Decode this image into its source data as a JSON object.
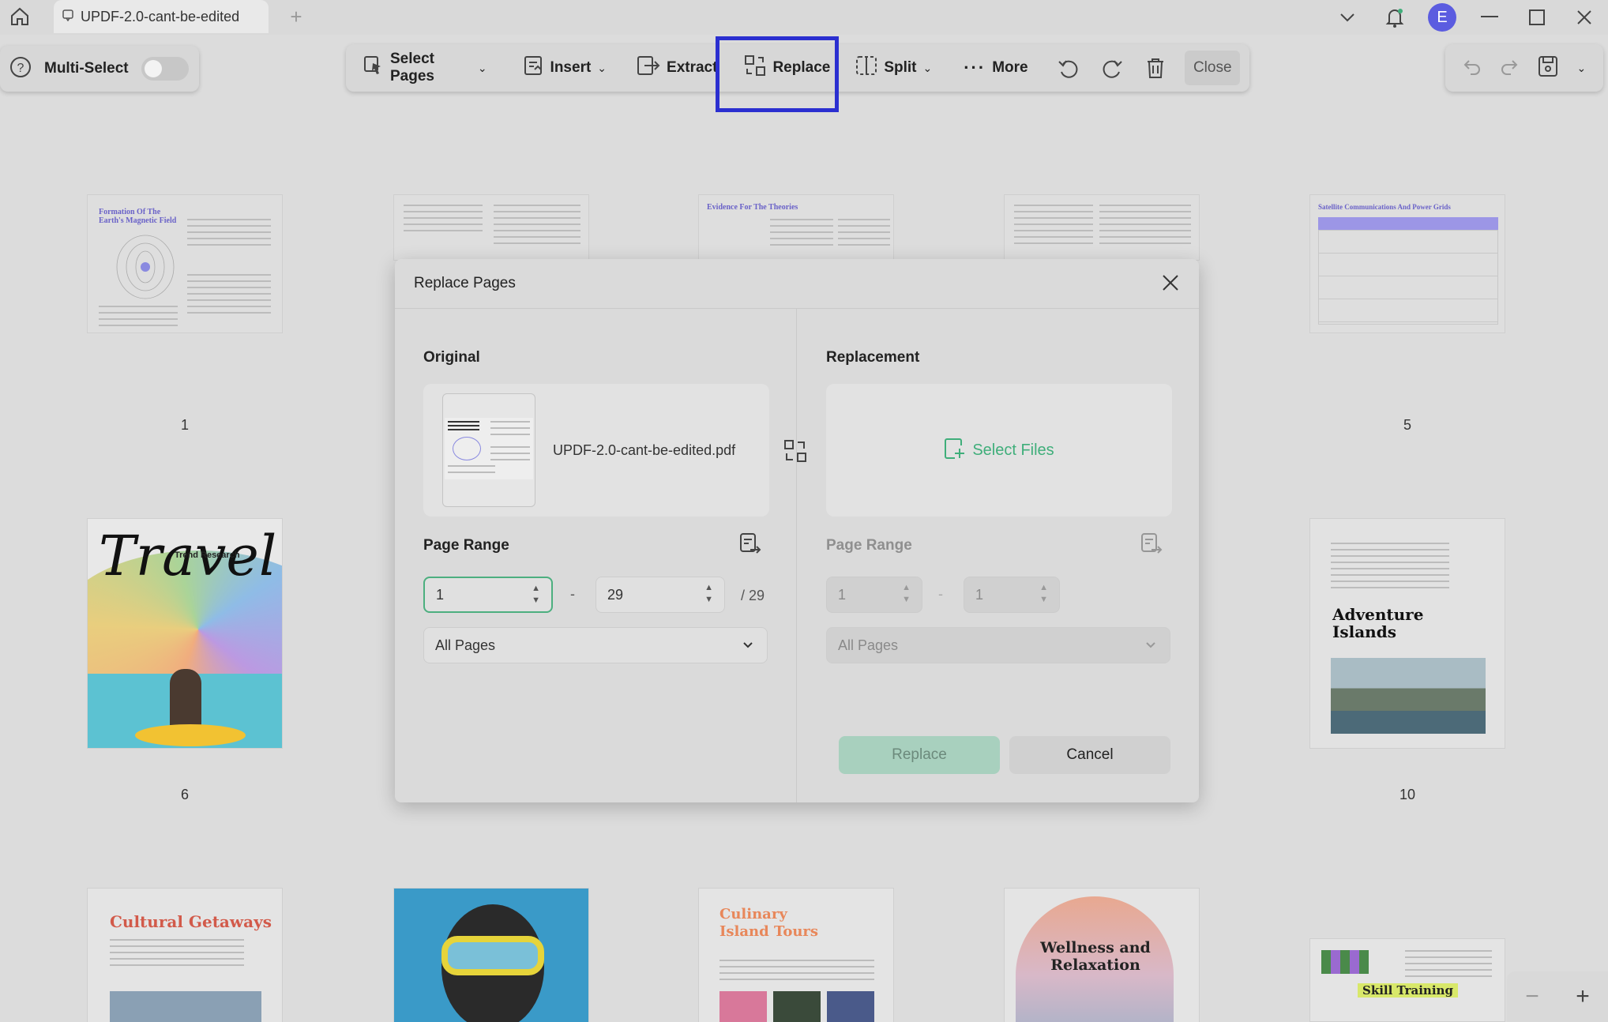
{
  "titlebar": {
    "tab_title": "UPDF-2.0-cant-be-edited",
    "avatar_initial": "E"
  },
  "toolbar": {
    "multi_select": "Multi-Select",
    "select_pages": "Select Pages",
    "insert": "Insert",
    "extract": "Extract",
    "replace": "Replace",
    "split": "Split",
    "more": "More",
    "close": "Close"
  },
  "pages": [
    {
      "num": "1",
      "title": "Formation Of The Earth's Magnetic Field"
    },
    {
      "num": "5",
      "title": "Satellite Communications And Power Grids"
    },
    {
      "num": "6",
      "title": "Travel",
      "subtitle": "Trend Research"
    },
    {
      "num": "10",
      "title": "Adventure Islands"
    },
    {
      "num": "",
      "title": "Cultural Getaways"
    },
    {
      "num": "",
      "title": "Culinary Island Tours"
    },
    {
      "num": "",
      "title": "Wellness and Relaxation"
    },
    {
      "num": "",
      "title": "Skill Training"
    },
    {
      "num": "",
      "title": "Evidence For The Theories"
    }
  ],
  "dialog": {
    "title": "Replace Pages",
    "original": {
      "label": "Original",
      "file_name": "UPDF-2.0-cant-be-edited.pdf",
      "page_range_label": "Page Range",
      "from": "1",
      "to": "29",
      "total": "/ 29",
      "dash": "-",
      "subset": "All Pages"
    },
    "replacement": {
      "label": "Replacement",
      "select_files": "Select Files",
      "page_range_label": "Page Range",
      "from": "1",
      "to": "1",
      "dash": "-",
      "subset": "All Pages"
    },
    "replace_button": "Replace",
    "cancel_button": "Cancel"
  },
  "colors": {
    "accent_green": "#3fae7a",
    "highlight_blue": "#2b2fd0",
    "avatar": "#5b5ce0"
  }
}
